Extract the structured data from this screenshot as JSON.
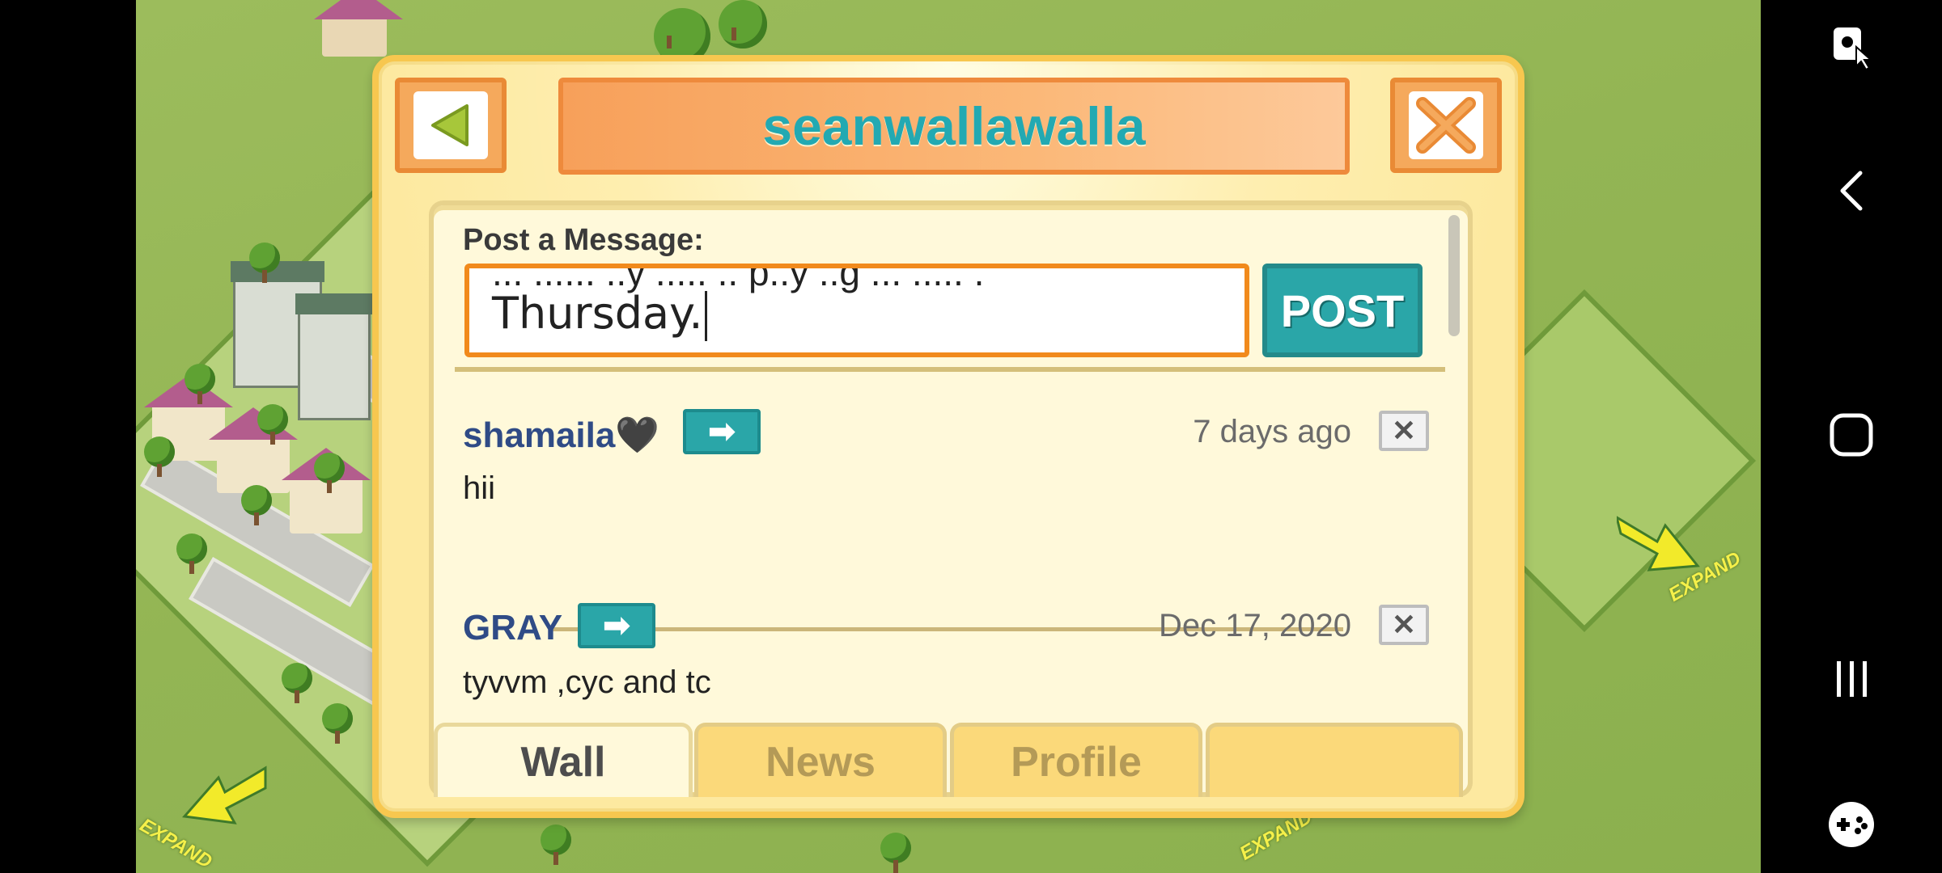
{
  "dialog": {
    "title": "seanwallawalla",
    "post_label": "Post a Message:",
    "message_prev_line": "... ...... ..y ..... .. p..y ..g ... ..... .",
    "message_value": "Thursday.",
    "post_button": "POST"
  },
  "posts": [
    {
      "author": "shamaila🖤",
      "date": "7 days ago",
      "body": "hii"
    },
    {
      "author": "GRAY",
      "date": "Dec 17, 2020",
      "body": "tyvvm ,cyc and tc"
    }
  ],
  "tabs": [
    {
      "label": "Wall",
      "active": true
    },
    {
      "label": "News",
      "active": false
    },
    {
      "label": "Profile",
      "active": false
    },
    {
      "label": "",
      "active": false
    }
  ],
  "scene": {
    "expand_labels": [
      "EXPAND",
      "EXPAND",
      "EXPAND"
    ]
  },
  "icons": {
    "back": "triangle-left-icon",
    "close": "x-close-icon",
    "go": "arrow-right-icon",
    "delete": "x-delete-icon"
  },
  "colors": {
    "accent_teal": "#2aa6a8",
    "title_teal": "#23a9b2",
    "author_blue": "#2f4b86",
    "input_orange": "#f18a1c",
    "dialog_yellow": "#fde9a0"
  }
}
